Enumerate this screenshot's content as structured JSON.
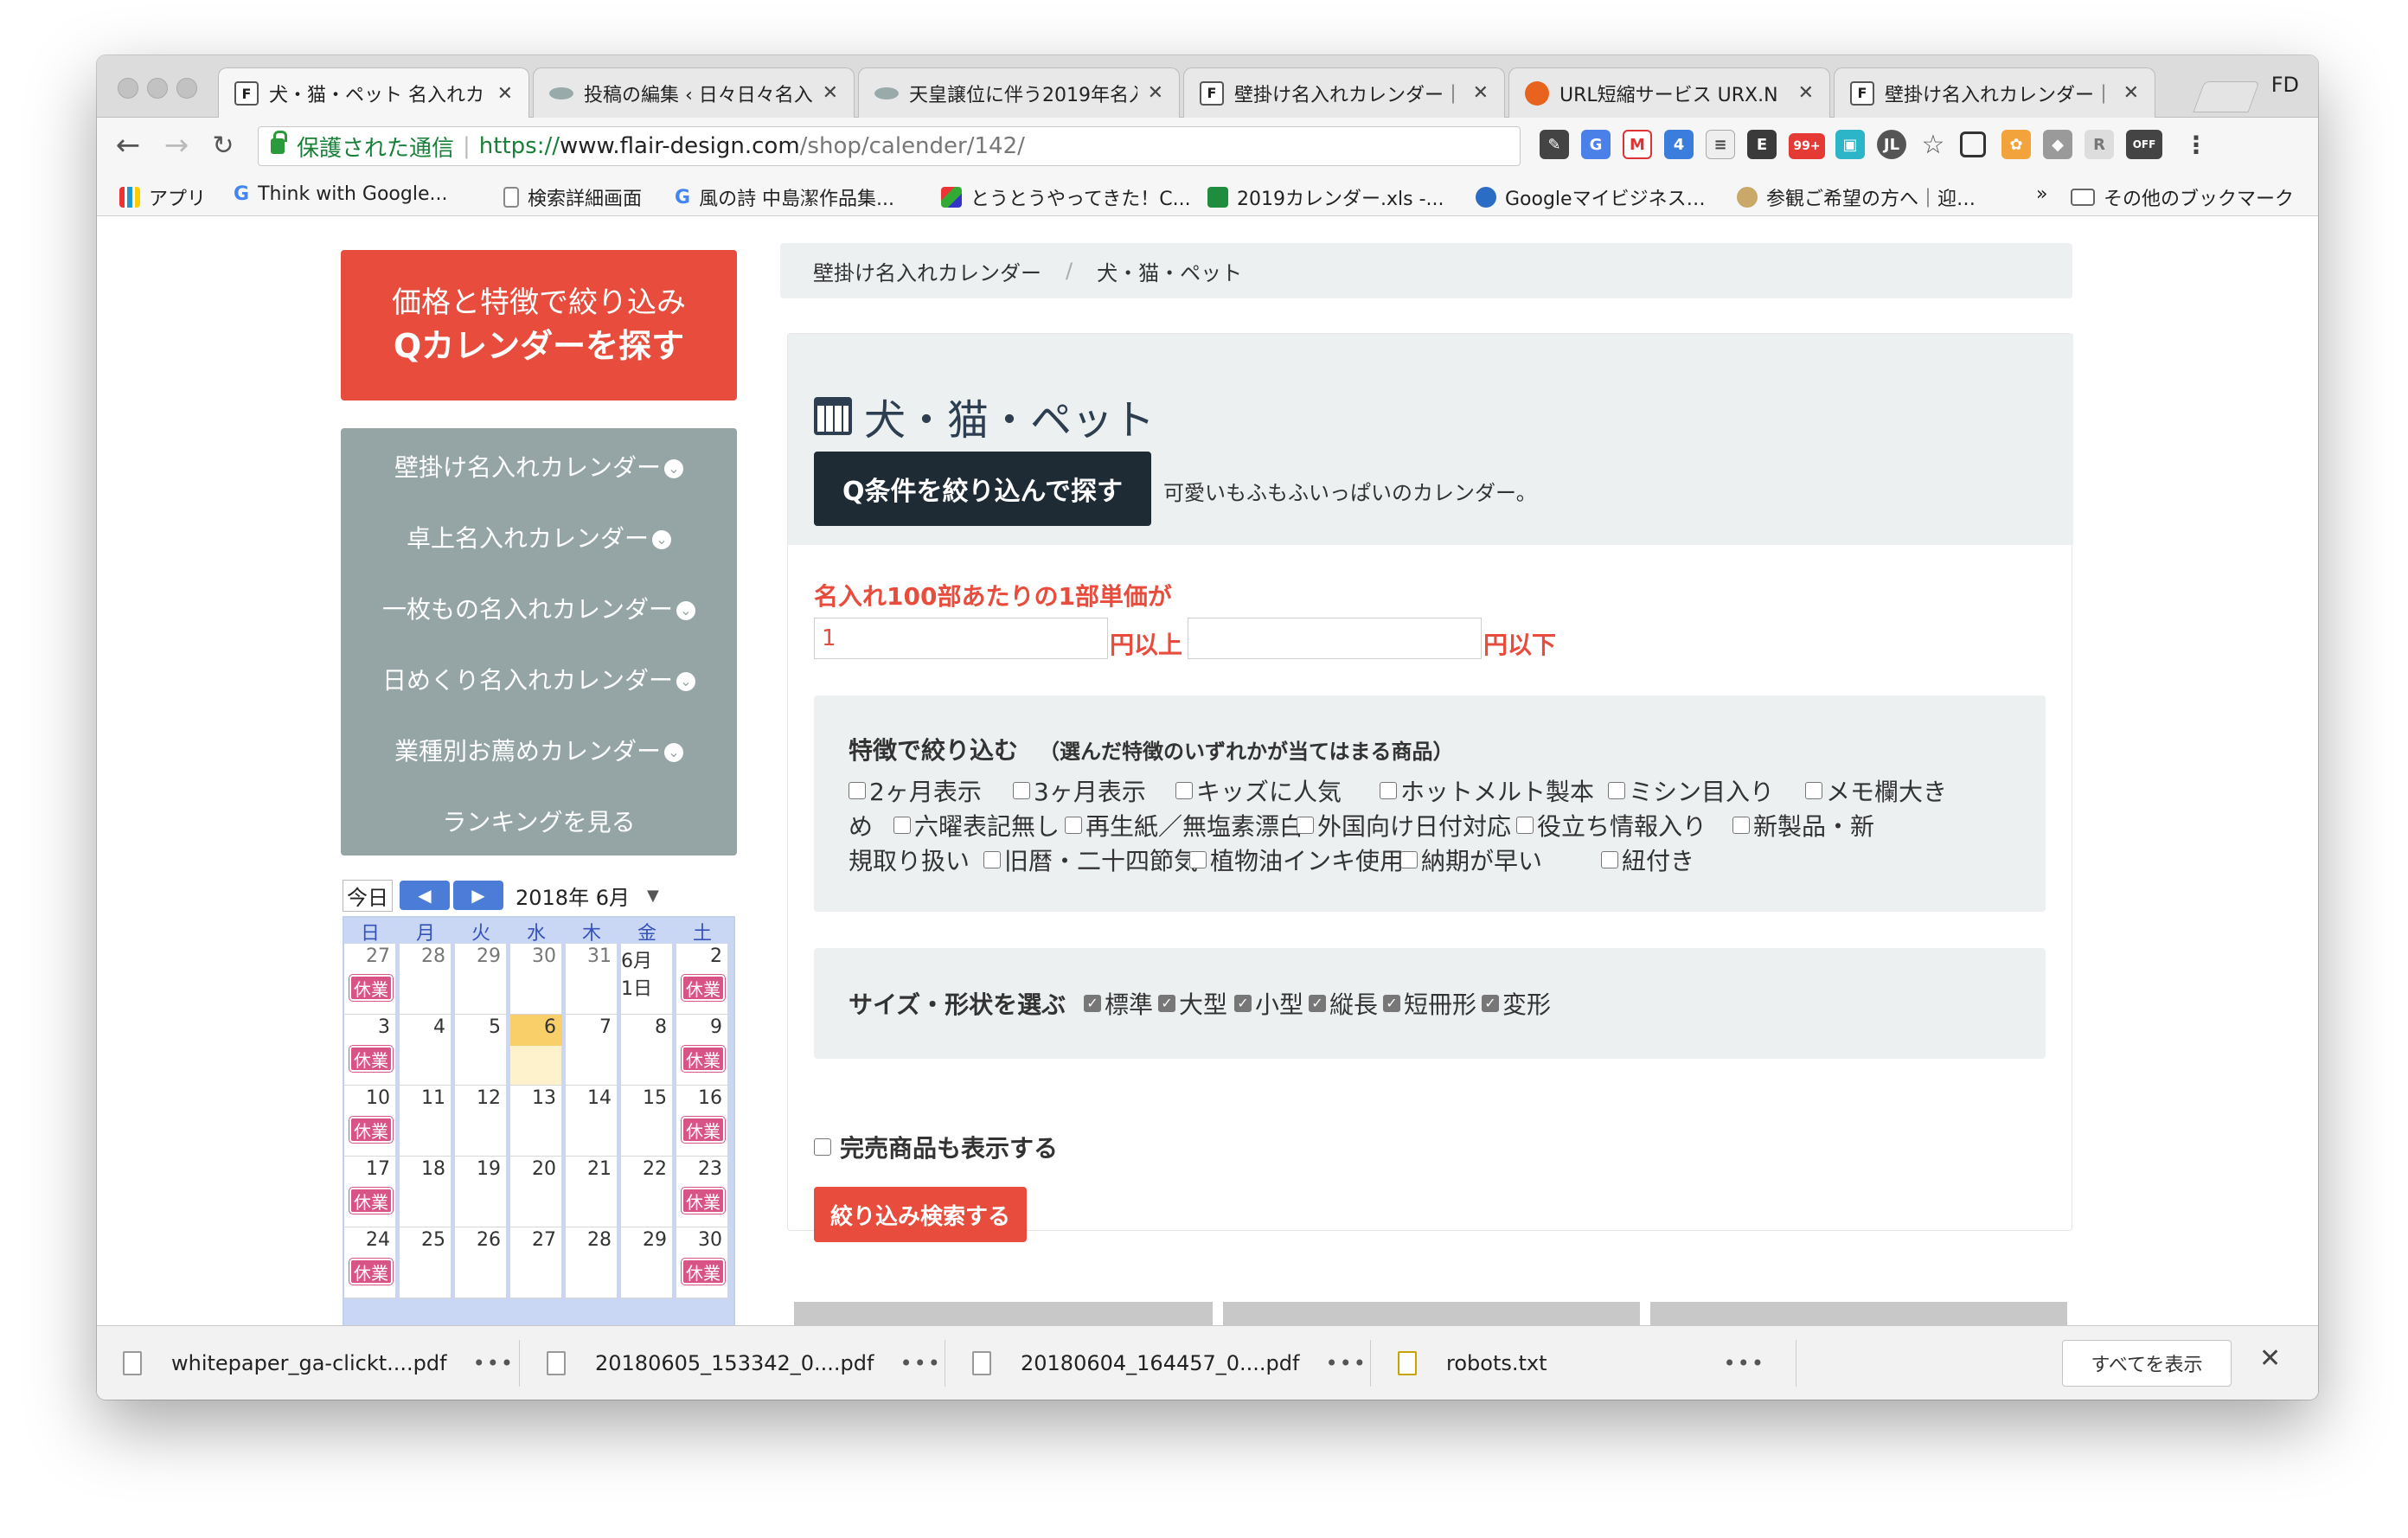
{
  "browser": {
    "tabs": [
      {
        "title": "犬・猫・ペット 名入れカレ",
        "active": true
      },
      {
        "title": "投稿の編集 ‹ 日々日々名入"
      },
      {
        "title": "天皇譲位に伴う2019年名入"
      },
      {
        "title": "壁掛け名入れカレンダー｜"
      },
      {
        "title": "URL短縮サービス URX.N"
      },
      {
        "title": "壁掛け名入れカレンダー｜"
      }
    ],
    "profile": "FD",
    "secure_label": "保護された通信",
    "url_scheme": "https://",
    "url_host": "www.flair-design.com",
    "url_path": "/shop/calender/142/",
    "ext_badge": "99+",
    "ext_off": "OFF",
    "bookmarks": [
      "アプリ",
      "Think with Google...",
      "検索詳細画面",
      "風の詩 中島潔作品集...",
      "とうとうやってきた！C...",
      "2019カレンダー.xls -...",
      "Googleマイビジネス…",
      "参観ご希望の方へ｜迎…",
      "»",
      "その他のブックマーク"
    ]
  },
  "sidebar": {
    "search_line1": "価格と特徴で絞り込み",
    "search_line2": "Qカレンダーを探す",
    "menu": [
      "壁掛け名入れカレンダー",
      "卓上名入れカレンダー",
      "一枚もの名入れカレンダー",
      "日めくり名入れカレンダー",
      "業種別お薦めカレンダー",
      "ランキングを見る"
    ],
    "chevron": "⌄"
  },
  "calendar": {
    "today_label": "今日",
    "prev": "◀",
    "next": "▶",
    "month": "2018年 6月",
    "weekdays": [
      "日",
      "月",
      "火",
      "水",
      "木",
      "金",
      "土"
    ],
    "off_label": "休業",
    "weeks": [
      [
        "27",
        "28",
        "29",
        "30",
        "31",
        "6月 1日",
        "2"
      ],
      [
        "3",
        "4",
        "5",
        "6",
        "7",
        "8",
        "9"
      ],
      [
        "10",
        "11",
        "12",
        "13",
        "14",
        "15",
        "16"
      ],
      [
        "17",
        "18",
        "19",
        "20",
        "21",
        "22",
        "23"
      ],
      [
        "24",
        "25",
        "26",
        "27",
        "28",
        "29",
        "30"
      ]
    ]
  },
  "breadcrumb": {
    "items": [
      "壁掛け名入れカレンダー",
      "犬・猫・ペット"
    ],
    "sep": "/"
  },
  "main": {
    "title": "犬・猫・ペット",
    "filter_button": "Q条件を絞り込んで探す",
    "description": "可愛いもふもふいっぱいのカレンダー。",
    "price_label": "名入れ100部あたりの1部単価が",
    "price_min_value": "1",
    "price_min_unit": "円以上",
    "price_max_value": "",
    "price_max_unit": "円以下",
    "features_title": "特徴で絞り込む",
    "features_note": "（選んだ特徴のいずれかが当てはまる商品）",
    "features_row1": [
      "2ヶ月表示",
      "3ヶ月表示",
      "キッズに人気",
      "ホットメルト製本",
      "ミシン目入り",
      "メモ欄大き"
    ],
    "features_row2_start": "め",
    "features_row2": [
      "六曜表記無し",
      "再生紙／無塩素漂白",
      "外国向け日付対応",
      "役立ち情報入り",
      "新製品・新"
    ],
    "features_row3_start": "規取り扱い",
    "features_row3": [
      "旧暦・二十四節気",
      "植物油インキ使用",
      "納期が早い",
      "紐付き"
    ],
    "size_title": "サイズ・形状を選ぶ",
    "sizes": [
      "標準",
      "大型",
      "小型",
      "縦長",
      "短冊形",
      "変形"
    ],
    "soldout_label": "完売商品も表示する",
    "search_button": "絞り込み検索する"
  },
  "downloads": {
    "files": [
      "whitepaper_ga-clickt....pdf",
      "20180605_153342_0....pdf",
      "20180604_164457_0....pdf",
      "robots.txt"
    ],
    "more": "•••",
    "show_all": "すべてを表示",
    "close": "✕"
  }
}
